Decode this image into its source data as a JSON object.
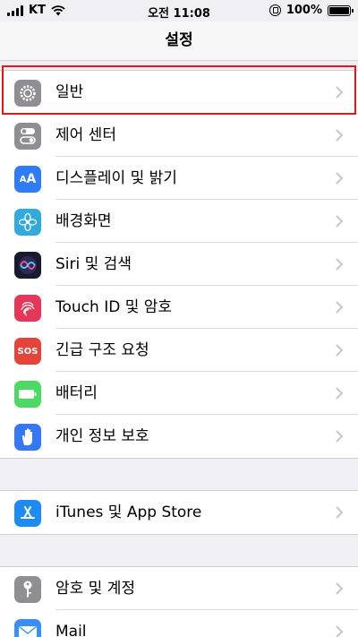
{
  "status": {
    "carrier": "KT",
    "time": "오전 11:08",
    "battery": "100%"
  },
  "nav": {
    "title": "설정"
  },
  "groups": [
    {
      "rows": [
        {
          "label": "일반",
          "icon": "gear-icon",
          "color": "#8e8e93"
        },
        {
          "label": "제어 센터",
          "icon": "control-center-icon",
          "color": "#8e8e93"
        },
        {
          "label": "디스플레이 및 밝기",
          "icon": "display-aa-icon",
          "color": "#2f7cf6"
        },
        {
          "label": "배경화면",
          "icon": "wallpaper-flower-icon",
          "color": "#33aadc"
        },
        {
          "label": "Siri 및 검색",
          "icon": "siri-icon",
          "color": "#1a1a2e"
        },
        {
          "label": "Touch ID 및 암호",
          "icon": "fingerprint-icon",
          "color": "#e6375a"
        },
        {
          "label": "긴급 구조 요청",
          "icon": "sos-icon",
          "color": "#e5443a",
          "text": "SOS"
        },
        {
          "label": "배터리",
          "icon": "battery-icon",
          "color": "#4cd964"
        },
        {
          "label": "개인 정보 보호",
          "icon": "hand-icon",
          "color": "#3478f6"
        }
      ]
    },
    {
      "rows": [
        {
          "label": "iTunes 및 App Store",
          "icon": "app-store-icon",
          "color": "#1e8bf3"
        }
      ]
    },
    {
      "rows": [
        {
          "label": "암호 및 계정",
          "icon": "key-icon",
          "color": "#8e8e93"
        },
        {
          "label": "Mail",
          "icon": "mail-icon",
          "color": "#3a8ff5"
        }
      ]
    }
  ]
}
